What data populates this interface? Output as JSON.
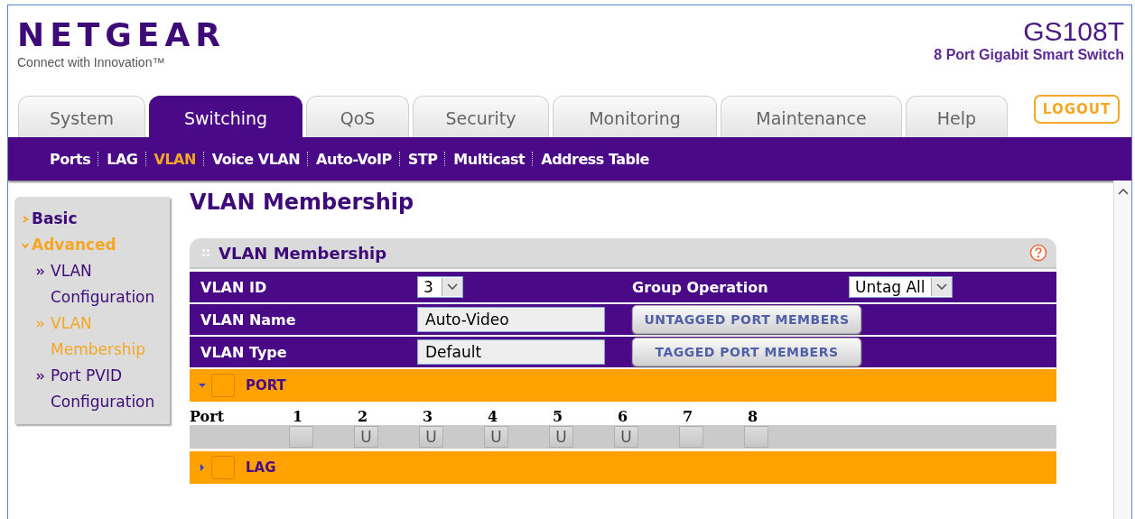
{
  "brand": {
    "logo": "NETGEAR",
    "tagline": "Connect with Innovation™",
    "model": "GS108T",
    "description": "8 Port Gigabit Smart Switch"
  },
  "tabs": [
    {
      "label": "System",
      "selected": false
    },
    {
      "label": "Switching",
      "selected": true
    },
    {
      "label": "QoS",
      "selected": false
    },
    {
      "label": "Security",
      "selected": false
    },
    {
      "label": "Monitoring",
      "selected": false
    },
    {
      "label": "Maintenance",
      "selected": false
    },
    {
      "label": "Help",
      "selected": false
    }
  ],
  "logout": "LOGOUT",
  "subnav": [
    {
      "label": "Ports",
      "selected": false
    },
    {
      "label": "LAG",
      "selected": false
    },
    {
      "label": "VLAN",
      "selected": true
    },
    {
      "label": "Voice VLAN",
      "selected": false
    },
    {
      "label": "Auto-VoIP",
      "selected": false
    },
    {
      "label": "STP",
      "selected": false
    },
    {
      "label": "Multicast",
      "selected": false
    },
    {
      "label": "Address Table",
      "selected": false
    }
  ],
  "sidebar": {
    "items": [
      {
        "label": "Basic",
        "expanded": false,
        "selected": false
      },
      {
        "label": "Advanced",
        "expanded": true,
        "selected": true,
        "children": [
          {
            "label": "VLAN Configuration",
            "selected": false
          },
          {
            "label": "VLAN Membership",
            "selected": true
          },
          {
            "label": "Port PVID Configuration",
            "selected": false
          }
        ]
      }
    ]
  },
  "page_title": "VLAN Membership",
  "panel": {
    "title": "VLAN Membership",
    "rows": [
      {
        "label": "VLAN ID",
        "field": {
          "kind": "select",
          "value": "3"
        },
        "extra": {
          "kind": "select",
          "label": "Group Operation",
          "value": "Untag All"
        }
      },
      {
        "label": "VLAN Name",
        "field": {
          "kind": "text",
          "value": "Auto-Video"
        },
        "extra": {
          "kind": "button",
          "label": "UNTAGGED PORT MEMBERS"
        }
      },
      {
        "label": "VLAN Type",
        "field": {
          "kind": "text",
          "value": "Default"
        },
        "extra": {
          "kind": "button",
          "label": "TAGGED PORT MEMBERS"
        }
      }
    ],
    "sections": [
      {
        "title": "PORT",
        "expanded": true,
        "row_label": "Port",
        "ports": [
          {
            "label": "1"
          },
          {
            "label": "2",
            "value": "U"
          },
          {
            "label": "3",
            "value": "U"
          },
          {
            "label": "4",
            "value": "U"
          },
          {
            "label": "5",
            "value": "U"
          },
          {
            "label": "6",
            "value": "U"
          },
          {
            "label": "7"
          },
          {
            "label": "8"
          }
        ]
      },
      {
        "title": "LAG",
        "expanded": false
      }
    ]
  }
}
